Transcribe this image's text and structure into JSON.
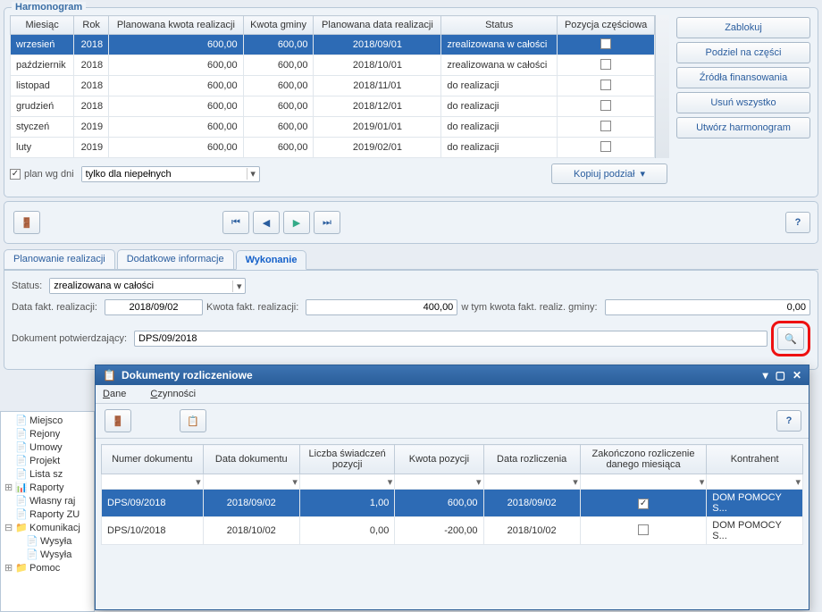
{
  "harmonogram": {
    "title": "Harmonogram",
    "columns": [
      "Miesiąc",
      "Rok",
      "Planowana kwota realizacji",
      "Kwota gminy",
      "Planowana data realizacji",
      "Status",
      "Pozycja częściowa"
    ],
    "rows": [
      {
        "miesiac": "wrzesień",
        "rok": "2018",
        "pkwota": "600,00",
        "kgminy": "600,00",
        "pdata": "2018/09/01",
        "status": "zrealizowana w całości",
        "partial": false,
        "selected": true
      },
      {
        "miesiac": "październik",
        "rok": "2018",
        "pkwota": "600,00",
        "kgminy": "600,00",
        "pdata": "2018/10/01",
        "status": "zrealizowana w całości",
        "partial": false
      },
      {
        "miesiac": "listopad",
        "rok": "2018",
        "pkwota": "600,00",
        "kgminy": "600,00",
        "pdata": "2018/11/01",
        "status": "do realizacji",
        "partial": false
      },
      {
        "miesiac": "grudzień",
        "rok": "2018",
        "pkwota": "600,00",
        "kgminy": "600,00",
        "pdata": "2018/12/01",
        "status": "do realizacji",
        "partial": false
      },
      {
        "miesiac": "styczeń",
        "rok": "2019",
        "pkwota": "600,00",
        "kgminy": "600,00",
        "pdata": "2019/01/01",
        "status": "do realizacji",
        "partial": false
      },
      {
        "miesiac": "luty",
        "rok": "2019",
        "pkwota": "600,00",
        "kgminy": "600,00",
        "pdata": "2019/02/01",
        "status": "do realizacji",
        "partial": false
      }
    ],
    "side_buttons": {
      "lock": "Zablokuj",
      "split": "Podziel na części",
      "sources": "Źródła finansowania",
      "delete_all": "Usuń wszystko",
      "create": "Utwórz harmonogram"
    },
    "plan_wg_dni_label": "plan wg dni",
    "plan_wg_dni_combo": "tylko dla niepełnych",
    "copy_split": "Kopiuj podział"
  },
  "tabs": {
    "t1": "Planowanie realizacji",
    "t2": "Dodatkowe informacje",
    "t3": "Wykonanie"
  },
  "wykonanie": {
    "status_label": "Status:",
    "status_value": "zrealizowana w całości",
    "data_fakt_label": "Data fakt. realizacji:",
    "data_fakt_value": "2018/09/02",
    "kwota_fakt_label": "Kwota fakt. realizacji:",
    "kwota_fakt_value": "400,00",
    "w_tym_label": "w tym kwota fakt. realiz. gminy:",
    "w_tym_value": "0,00",
    "dokument_label": "Dokument potwierdzający:",
    "dokument_value": "DPS/09/2018"
  },
  "dialog": {
    "title": "Dokumenty rozliczeniowe",
    "menu_dane": "Dane",
    "menu_czynnosci": "Czynności",
    "columns": [
      "Numer dokumentu",
      "Data dokumentu",
      "Liczba świadczeń pozycji",
      "Kwota pozycji",
      "Data rozliczenia",
      "Zakończono rozliczenie danego miesiąca",
      "Kontrahent"
    ],
    "rows": [
      {
        "nr": "DPS/09/2018",
        "data": "2018/09/02",
        "liczba": "1,00",
        "kwota": "600,00",
        "rozl": "2018/09/02",
        "zak": true,
        "kontr": "DOM POMOCY S...",
        "selected": true
      },
      {
        "nr": "DPS/10/2018",
        "data": "2018/10/02",
        "liczba": "0,00",
        "kwota": "-200,00",
        "rozl": "2018/10/02",
        "zak": false,
        "kontr": "DOM POMOCY S..."
      }
    ]
  },
  "tree": {
    "items": [
      {
        "icon": "📄",
        "label": "Miejsco"
      },
      {
        "icon": "📄",
        "label": "Rejony"
      },
      {
        "icon": "📄",
        "label": "Umowy"
      },
      {
        "icon": "📄",
        "label": "Projekt"
      },
      {
        "icon": "📄",
        "label": "Lista sz"
      },
      {
        "icon": "📊",
        "label": "Raporty",
        "folder": true
      },
      {
        "icon": "📄",
        "label": "Własny raj"
      },
      {
        "icon": "📄",
        "label": "Raporty ZU"
      },
      {
        "icon": "📁",
        "label": "Komunikacj",
        "folder": true,
        "open": true
      },
      {
        "icon": "📄",
        "label": "Wysyła",
        "indent": 1
      },
      {
        "icon": "📄",
        "label": "Wysyła",
        "indent": 1
      },
      {
        "icon": "📁",
        "label": "Pomoc",
        "folder": true
      }
    ]
  }
}
